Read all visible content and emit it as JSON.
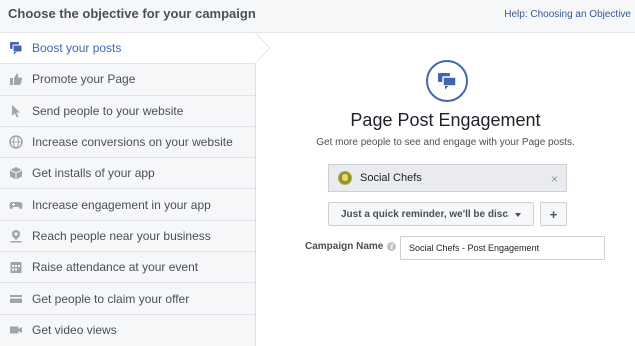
{
  "header": {
    "title": "Choose the objective for your campaign",
    "help_link": "Help: Choosing an Objective"
  },
  "sidebar": {
    "items": [
      {
        "label": "Boost your posts",
        "icon": "boost-posts-icon",
        "active": true
      },
      {
        "label": "Promote your Page",
        "icon": "thumbs-up-icon",
        "active": false
      },
      {
        "label": "Send people to your website",
        "icon": "cursor-icon",
        "active": false
      },
      {
        "label": "Increase conversions on your website",
        "icon": "globe-icon",
        "active": false
      },
      {
        "label": "Get installs of your app",
        "icon": "box-icon",
        "active": false
      },
      {
        "label": "Increase engagement in your app",
        "icon": "gamepad-icon",
        "active": false
      },
      {
        "label": "Reach people near your business",
        "icon": "map-pin-icon",
        "active": false
      },
      {
        "label": "Raise attendance at your event",
        "icon": "calendar-icon",
        "active": false
      },
      {
        "label": "Get people to claim your offer",
        "icon": "offer-tag-icon",
        "active": false
      },
      {
        "label": "Get video views",
        "icon": "video-camera-icon",
        "active": false
      }
    ]
  },
  "main": {
    "title": "Page Post Engagement",
    "subtitle": "Get more people to see and engage with your Page posts.",
    "page_selector": {
      "value": "Social Chefs",
      "clear": "×"
    },
    "post_dropdown": {
      "value": "Just a quick reminder, we'll be disc..."
    },
    "add_button": "+",
    "campaign_name": {
      "label": "Campaign Name",
      "info": "i",
      "value": "Social Chefs - Post Engagement"
    }
  },
  "colors": {
    "accent": "#4267b2",
    "sidebar_bg": "#f6f7f9",
    "text": "#4b4f56"
  }
}
